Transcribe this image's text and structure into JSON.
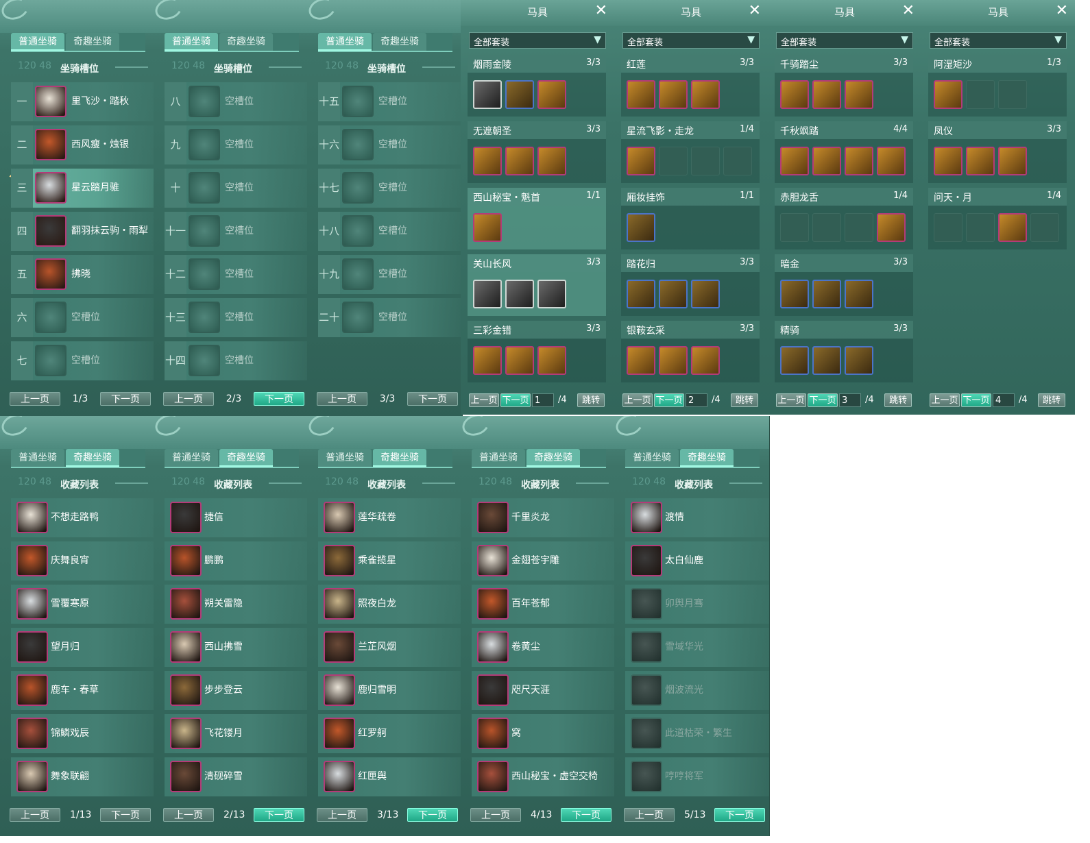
{
  "tabs": {
    "normal": "普通坐骑",
    "fun": "奇趣坐骑"
  },
  "mount_slots_title": "坐骑槽位",
  "collection_title": "收藏列表",
  "level_hint": "120 48",
  "pager": {
    "prev": "上一页",
    "next": "下一页",
    "jump": "跳转"
  },
  "normal_pages": [
    {
      "page": "1/3",
      "slots": [
        {
          "num": "一",
          "name": "里飞沙・踏秋",
          "filled": true
        },
        {
          "num": "二",
          "name": "西风瘦・烛银",
          "filled": true
        },
        {
          "num": "三",
          "name": "星云踏月骓",
          "filled": true,
          "selected": true
        },
        {
          "num": "四",
          "name": "翻羽抹云驹・雨犁",
          "filled": true
        },
        {
          "num": "五",
          "name": "拂晓",
          "filled": true
        },
        {
          "num": "六",
          "name": "空槽位",
          "filled": false
        },
        {
          "num": "七",
          "name": "空槽位",
          "filled": false
        }
      ]
    },
    {
      "page": "2/3",
      "slots": [
        {
          "num": "八",
          "name": "空槽位",
          "filled": false
        },
        {
          "num": "九",
          "name": "空槽位",
          "filled": false
        },
        {
          "num": "十",
          "name": "空槽位",
          "filled": false
        },
        {
          "num": "十一",
          "name": "空槽位",
          "filled": false
        },
        {
          "num": "十二",
          "name": "空槽位",
          "filled": false
        },
        {
          "num": "十三",
          "name": "空槽位",
          "filled": false
        },
        {
          "num": "十四",
          "name": "空槽位",
          "filled": false
        }
      ]
    },
    {
      "page": "3/3",
      "slots": [
        {
          "num": "十五",
          "name": "空槽位",
          "filled": false
        },
        {
          "num": "十六",
          "name": "空槽位",
          "filled": false
        },
        {
          "num": "十七",
          "name": "空槽位",
          "filled": false
        },
        {
          "num": "十八",
          "name": "空槽位",
          "filled": false
        },
        {
          "num": "十九",
          "name": "空槽位",
          "filled": false
        },
        {
          "num": "二十",
          "name": "空槽位",
          "filled": false
        }
      ]
    }
  ],
  "tack_window": {
    "title": "马具",
    "filter": "全部套装"
  },
  "tack_pages": [
    {
      "page": "1",
      "total": "/4",
      "sets": [
        {
          "name": "烟雨金陵",
          "count": "3/3",
          "slots": [
            "w",
            "b",
            "f"
          ]
        },
        {
          "name": "无遮朝圣",
          "count": "3/3",
          "slots": [
            "f",
            "f",
            "f"
          ]
        },
        {
          "name": "西山秘宝・魁首",
          "count": "1/1",
          "slots": [
            "f"
          ],
          "hl": true
        },
        {
          "name": "关山长风",
          "count": "3/3",
          "slots": [
            "w",
            "w",
            "w"
          ],
          "hl": true
        },
        {
          "name": "三彩金错",
          "count": "3/3",
          "slots": [
            "f",
            "f",
            "f"
          ]
        }
      ]
    },
    {
      "page": "2",
      "total": "/4",
      "sets": [
        {
          "name": "红莲",
          "count": "3/3",
          "slots": [
            "f",
            "f",
            "f"
          ]
        },
        {
          "name": "星流飞影・走龙",
          "count": "1/4",
          "slots": [
            "f",
            "e",
            "e",
            "e"
          ]
        },
        {
          "name": "厢妆挂饰",
          "count": "1/1",
          "slots": [
            "b"
          ]
        },
        {
          "name": "踏花归",
          "count": "3/3",
          "slots": [
            "b",
            "b",
            "b"
          ]
        },
        {
          "name": "银鞍玄采",
          "count": "3/3",
          "slots": [
            "f",
            "f",
            "f"
          ]
        }
      ]
    },
    {
      "page": "3",
      "total": "/4",
      "sets": [
        {
          "name": "千骑踏尘",
          "count": "3/3",
          "slots": [
            "f",
            "f",
            "f"
          ]
        },
        {
          "name": "千秋飒踏",
          "count": "4/4",
          "slots": [
            "f",
            "f",
            "f",
            "f"
          ]
        },
        {
          "name": "赤胆龙舌",
          "count": "1/4",
          "slots": [
            "e",
            "e",
            "e",
            "f"
          ]
        },
        {
          "name": "暗金",
          "count": "3/3",
          "slots": [
            "b",
            "b",
            "b"
          ]
        },
        {
          "name": "精骑",
          "count": "3/3",
          "slots": [
            "b",
            "b",
            "b"
          ]
        }
      ]
    },
    {
      "page": "4",
      "total": "/4",
      "sets": [
        {
          "name": "阿湿矩沙",
          "count": "1/3",
          "slots": [
            "f",
            "e",
            "e"
          ]
        },
        {
          "name": "凤仪",
          "count": "3/3",
          "slots": [
            "f",
            "f",
            "f"
          ]
        },
        {
          "name": "问天・月",
          "count": "1/4",
          "slots": [
            "e",
            "e",
            "f",
            "e"
          ]
        }
      ]
    }
  ],
  "collection_pages": [
    {
      "page": "1/13",
      "items": [
        {
          "name": "不想走路鸭"
        },
        {
          "name": "庆舞良宵"
        },
        {
          "name": "雪覆寒原"
        },
        {
          "name": "望月归"
        },
        {
          "name": "鹿车・春草"
        },
        {
          "name": "锦鳞戏辰"
        },
        {
          "name": "舞象联翩"
        }
      ]
    },
    {
      "page": "2/13",
      "items": [
        {
          "name": "捷信"
        },
        {
          "name": "鹏鹏"
        },
        {
          "name": "朔关雷隐"
        },
        {
          "name": "西山拂雪"
        },
        {
          "name": "步步登云"
        },
        {
          "name": "飞花镂月"
        },
        {
          "name": "清砚碎雪"
        }
      ]
    },
    {
      "page": "3/13",
      "items": [
        {
          "name": "莲华疏卷"
        },
        {
          "name": "乘雀揽星"
        },
        {
          "name": "照夜白龙"
        },
        {
          "name": "兰芷风烟"
        },
        {
          "name": "鹿归雪明"
        },
        {
          "name": "红罗舸"
        },
        {
          "name": "红匣舆"
        }
      ]
    },
    {
      "page": "4/13",
      "items": [
        {
          "name": "千里炎龙"
        },
        {
          "name": "金翅苍宇雕"
        },
        {
          "name": "百年苍郁"
        },
        {
          "name": "卷黄尘"
        },
        {
          "name": "咫尺天涯"
        },
        {
          "name": "窝"
        },
        {
          "name": "西山秘宝・虚空交椅"
        }
      ]
    },
    {
      "page": "5/13",
      "items": [
        {
          "name": "渡情"
        },
        {
          "name": "太白仙鹿"
        },
        {
          "name": "卯舆月骞",
          "dim": true
        },
        {
          "name": "雪域华光",
          "dim": true
        },
        {
          "name": "烟波流光",
          "dim": true
        },
        {
          "name": "此道枯荣・繁生",
          "dim": true
        },
        {
          "name": "哼哼将军",
          "dim": true
        }
      ]
    }
  ],
  "colors": {
    "accent": "#66b8a6",
    "frame_filled": "#b43b78",
    "highlight_btn": "#20a887"
  }
}
